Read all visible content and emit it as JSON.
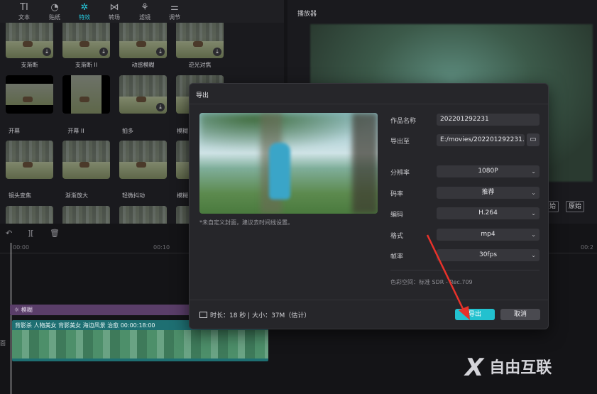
{
  "toolbar": {
    "items": [
      {
        "label": "文本",
        "icon": "TI"
      },
      {
        "label": "贴纸",
        "icon": "◔"
      },
      {
        "label": "特效",
        "icon": "✲"
      },
      {
        "label": "转场",
        "icon": "⋈"
      },
      {
        "label": "滤镜",
        "icon": "⚘"
      },
      {
        "label": "调节",
        "icon": "⚌"
      }
    ]
  },
  "effects": {
    "row1": [
      "支渐断",
      "支渐断 II",
      "动感模糊",
      "逆光对焦"
    ],
    "row2": [
      "开幕",
      "开幕 II",
      "拍多",
      "模糊"
    ],
    "row3": [
      "镜头变焦",
      "渐渐放大",
      "轻微抖动",
      "模糊"
    ]
  },
  "player": {
    "title": "播放器",
    "btn1": "原始",
    "btn2": "原始"
  },
  "timeline": {
    "ruler": [
      "00:00",
      "00:10",
      "00:2"
    ],
    "fx_clip": "模糊",
    "video_label": "背影杀 人物美女 背影美女 海边风景 治愈   00:00:18:00",
    "track_label": "面"
  },
  "dialog": {
    "title": "导出",
    "cover_hint": "*未自定义封面，建议去时间线设置。",
    "fields": {
      "name_label": "作品名称",
      "name_value": "202201292231",
      "path_label": "导出至",
      "path_value": "E:/movies/202201292231...",
      "resolution_label": "分辨率",
      "resolution_value": "1080P",
      "bitrate_label": "码率",
      "bitrate_value": "推荐",
      "codec_label": "编码",
      "codec_value": "H.264",
      "format_label": "格式",
      "format_value": "mp4",
      "fps_label": "帧率",
      "fps_value": "30fps"
    },
    "color_space": "色彩空间：标准 SDR - Rec.709",
    "footer_info": "时长：18 秒  |  大小：37M（估计）",
    "export_label": "导出",
    "cancel_label": "取消"
  },
  "watermark": {
    "mark": "X",
    "text": "自由互联"
  },
  "colors": {
    "accent": "#22c1cf",
    "arrow": "#e8322a"
  }
}
